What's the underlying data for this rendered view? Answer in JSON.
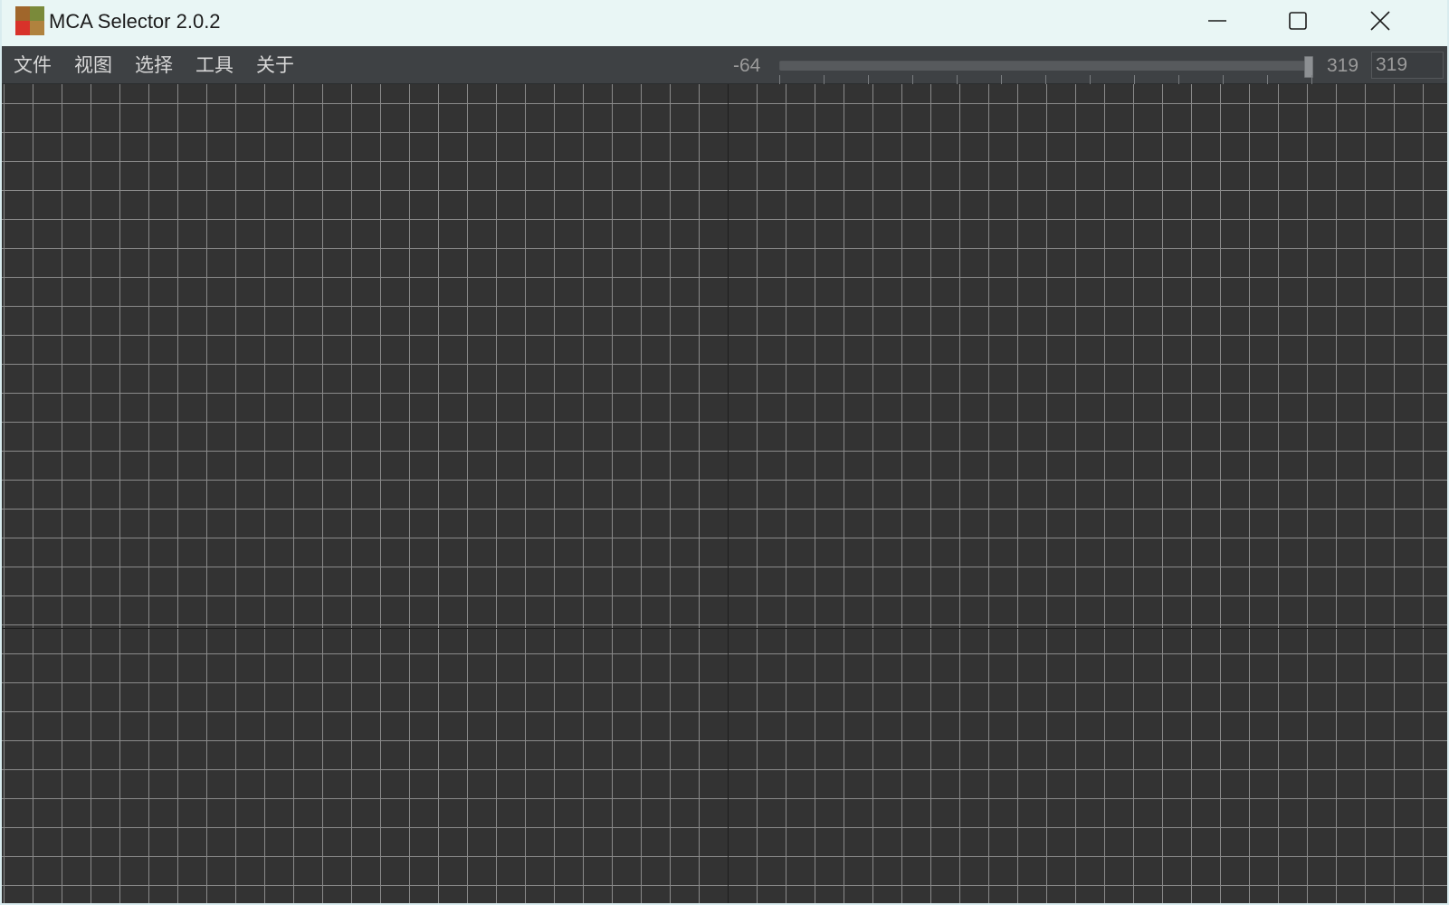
{
  "window": {
    "title": "MCA Selector 2.0.2",
    "icon": "app-block-icon"
  },
  "title_buttons": {
    "minimize": "minimize-icon",
    "maximize": "maximize-icon",
    "close": "close-icon"
  },
  "menu": {
    "items": [
      {
        "label": "文件"
      },
      {
        "label": "视图"
      },
      {
        "label": "选择"
      },
      {
        "label": "工具"
      },
      {
        "label": "关于"
      }
    ]
  },
  "height_slider": {
    "min_label": "-64",
    "max_label": "319",
    "value": 319,
    "min": -64,
    "max": 319,
    "tick_count": 13,
    "input_value": "319"
  },
  "colors": {
    "map_background": "#333333",
    "grid_line": "#8a8a8a",
    "axis_line": "#1e1e1e",
    "toolbar": "#3e4144",
    "titlebar": "#e9f6f5"
  }
}
